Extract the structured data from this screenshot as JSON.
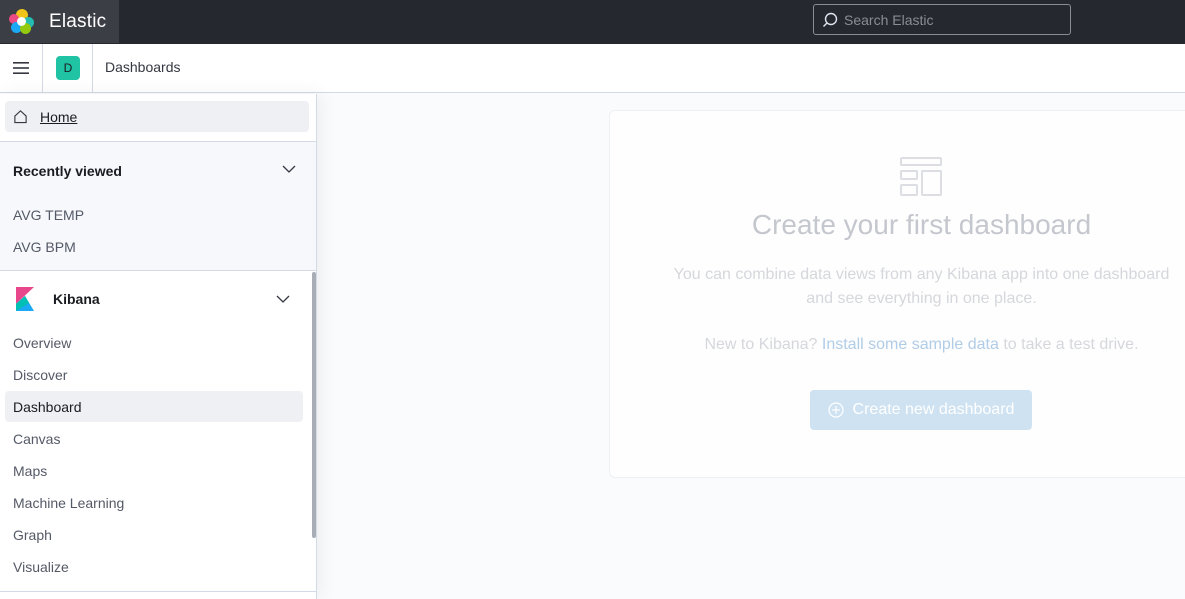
{
  "header": {
    "brand": "Elastic",
    "search_placeholder": "Search Elastic"
  },
  "subheader": {
    "space_initial": "D",
    "breadcrumb": "Dashboards"
  },
  "nav": {
    "home": "Home",
    "recent": {
      "title": "Recently viewed",
      "items": [
        "AVG TEMP",
        "AVG BPM"
      ]
    },
    "kibana": {
      "title": "Kibana",
      "items": [
        "Overview",
        "Discover",
        "Dashboard",
        "Canvas",
        "Maps",
        "Machine Learning",
        "Graph",
        "Visualize"
      ],
      "active": "Dashboard"
    }
  },
  "empty_state": {
    "title": "Create your first dashboard",
    "body_line1": "You can combine data views from any Kibana app into one dashboard",
    "body_line2": "and see everything in one place.",
    "prompt_prefix": "New to Kibana?",
    "prompt_link": "Install some sample data",
    "prompt_suffix": "to take a test drive.",
    "button": "Create new dashboard"
  },
  "colors": {
    "header_bg": "#25282f",
    "space_avatar": "#20c4a4",
    "accent_link": "#0077cc"
  }
}
